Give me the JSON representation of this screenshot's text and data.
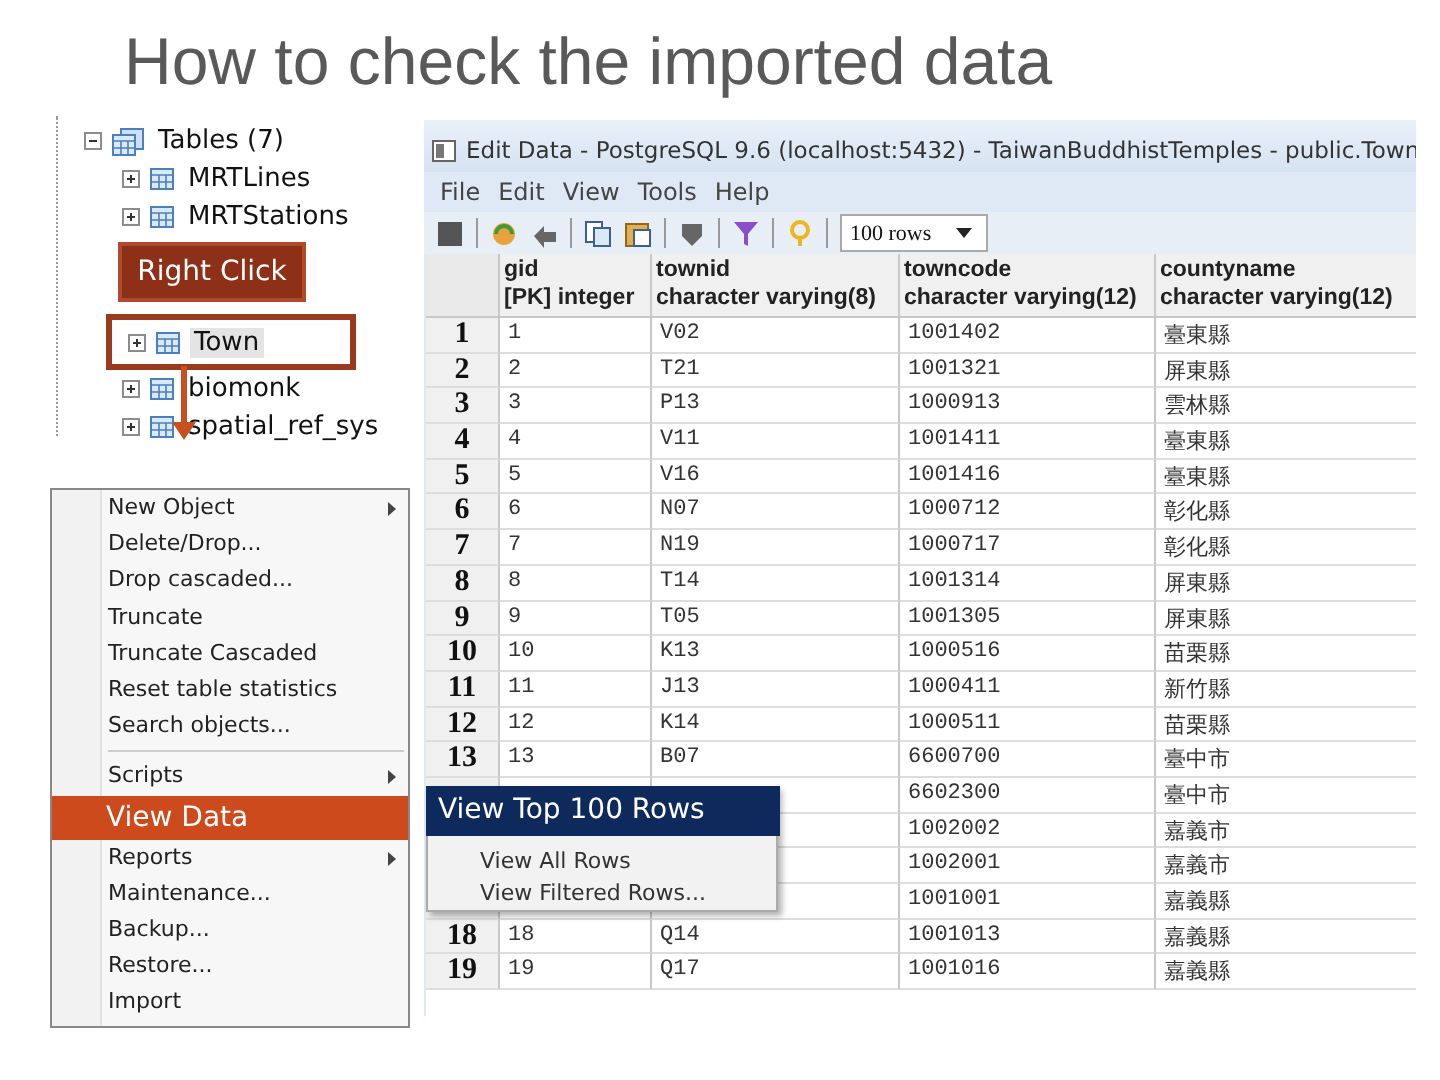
{
  "title": "How to check the imported data",
  "tree": {
    "label": "Tables (7)",
    "expanded": true,
    "children": [
      {
        "label": "MRTLines",
        "highlighted": false
      },
      {
        "label": "MRTStations",
        "highlighted": false
      },
      {
        "label": "Town",
        "highlighted": true
      },
      {
        "label": "biomonk",
        "highlighted": false
      },
      {
        "label": "spatial_ref_sys",
        "highlighted": false
      }
    ],
    "callout": "Right Click"
  },
  "context_menu": [
    {
      "kind": "item",
      "label": "New Object",
      "submenu": true,
      "highlighted": false
    },
    {
      "kind": "item",
      "label": "Delete/Drop...",
      "submenu": false,
      "highlighted": false
    },
    {
      "kind": "item",
      "label": "Drop cascaded...",
      "submenu": false,
      "highlighted": false
    },
    {
      "kind": "item",
      "label": "Truncate",
      "submenu": false,
      "highlighted": false
    },
    {
      "kind": "item",
      "label": "Truncate Cascaded",
      "submenu": false,
      "highlighted": false
    },
    {
      "kind": "item",
      "label": "Reset table statistics",
      "submenu": false,
      "highlighted": false
    },
    {
      "kind": "item",
      "label": "Search objects...",
      "submenu": false,
      "highlighted": false
    },
    {
      "kind": "separator"
    },
    {
      "kind": "item",
      "label": "Scripts",
      "submenu": true,
      "highlighted": false
    },
    {
      "kind": "item",
      "label": "View Data",
      "submenu": false,
      "highlighted": true
    },
    {
      "kind": "item",
      "label": "Reports",
      "submenu": true,
      "highlighted": false
    },
    {
      "kind": "item",
      "label": "Maintenance...",
      "submenu": false,
      "highlighted": false
    },
    {
      "kind": "item",
      "label": "Backup...",
      "submenu": false,
      "highlighted": false
    },
    {
      "kind": "item",
      "label": "Restore...",
      "submenu": false,
      "highlighted": false
    },
    {
      "kind": "item",
      "label": "Import",
      "submenu": false,
      "highlighted": false
    }
  ],
  "submenu": [
    {
      "label": "View Top 100 Rows",
      "highlighted": true
    },
    {
      "label": "View All Rows",
      "highlighted": false
    },
    {
      "label": "View Filtered Rows...",
      "highlighted": false
    }
  ],
  "window": {
    "title": "Edit Data - PostgreSQL 9.6 (localhost:5432) - TaiwanBuddhistTemples - public.Town",
    "menu": [
      "File",
      "Edit",
      "View",
      "Tools",
      "Help"
    ],
    "row_limit": "100 rows"
  },
  "table": {
    "columns": [
      {
        "name": "gid",
        "type": "[PK] integer"
      },
      {
        "name": "townid",
        "type": "character varying(8)"
      },
      {
        "name": "towncode",
        "type": "character varying(12)"
      },
      {
        "name": "countyname",
        "type": "character varying(12)"
      }
    ],
    "rows": [
      {
        "number": "1",
        "cells": [
          "1",
          "V02",
          "1001402",
          "臺東縣"
        ]
      },
      {
        "number": "2",
        "cells": [
          "2",
          "T21",
          "1001321",
          "屏東縣"
        ]
      },
      {
        "number": "3",
        "cells": [
          "3",
          "P13",
          "1000913",
          "雲林縣"
        ]
      },
      {
        "number": "4",
        "cells": [
          "4",
          "V11",
          "1001411",
          "臺東縣"
        ]
      },
      {
        "number": "5",
        "cells": [
          "5",
          "V16",
          "1001416",
          "臺東縣"
        ]
      },
      {
        "number": "6",
        "cells": [
          "6",
          "N07",
          "1000712",
          "彰化縣"
        ]
      },
      {
        "number": "7",
        "cells": [
          "7",
          "N19",
          "1000717",
          "彰化縣"
        ]
      },
      {
        "number": "8",
        "cells": [
          "8",
          "T14",
          "1001314",
          "屏東縣"
        ]
      },
      {
        "number": "9",
        "cells": [
          "9",
          "T05",
          "1001305",
          "屏東縣"
        ]
      },
      {
        "number": "10",
        "cells": [
          "10",
          "K13",
          "1000516",
          "苗栗縣"
        ]
      },
      {
        "number": "11",
        "cells": [
          "11",
          "J13",
          "1000411",
          "新竹縣"
        ]
      },
      {
        "number": "12",
        "cells": [
          "12",
          "K14",
          "1000511",
          "苗栗縣"
        ]
      },
      {
        "number": "13",
        "cells": [
          "13",
          "B07",
          "6600700",
          "臺中市"
        ]
      },
      {
        "number": "",
        "cells": [
          "",
          "",
          "6602300",
          "臺中市"
        ]
      },
      {
        "number": "",
        "cells": [
          "",
          "",
          "1002002",
          "嘉義市"
        ]
      },
      {
        "number": "",
        "cells": [
          "",
          "",
          "1002001",
          "嘉義市"
        ]
      },
      {
        "number": "",
        "cells": [
          "",
          "",
          "1001001",
          "嘉義縣"
        ]
      },
      {
        "number": "18",
        "cells": [
          "18",
          "Q14",
          "1001013",
          "嘉義縣"
        ]
      },
      {
        "number": "19",
        "cells": [
          "19",
          "Q17",
          "1001016",
          "嘉義縣"
        ]
      }
    ]
  }
}
